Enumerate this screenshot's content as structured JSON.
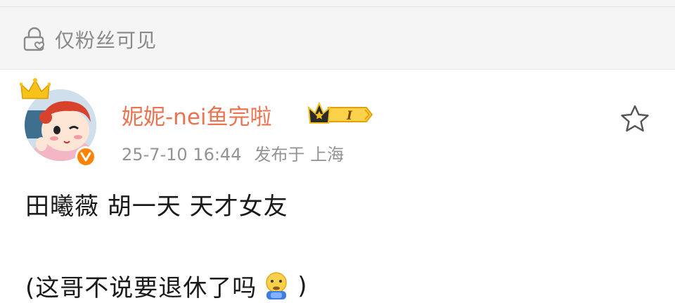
{
  "visibility": {
    "label": "仅粉丝可见",
    "icon": "lock-heart-icon"
  },
  "post": {
    "author": {
      "name": "妮妮-nei鱼完啦",
      "verified_badge": "orange-v-icon",
      "crown": "crown-icon",
      "level_badge": "vip-level-badge-icon"
    },
    "time": "25-7-10 16:44",
    "location": "发布于 上海",
    "favorite_icon": "star-outline-icon",
    "content": {
      "line1": "田曦薇 胡一天 天才女友",
      "line2_prefix": "(这哥不说要退休了吗",
      "line2_emoji": "cold-sweat-emoji",
      "line2_suffix": ")"
    }
  },
  "colors": {
    "username": "#eb7350",
    "meta": "#939393",
    "verified": "#ff8200",
    "privacy_text": "#8a8a8a"
  }
}
